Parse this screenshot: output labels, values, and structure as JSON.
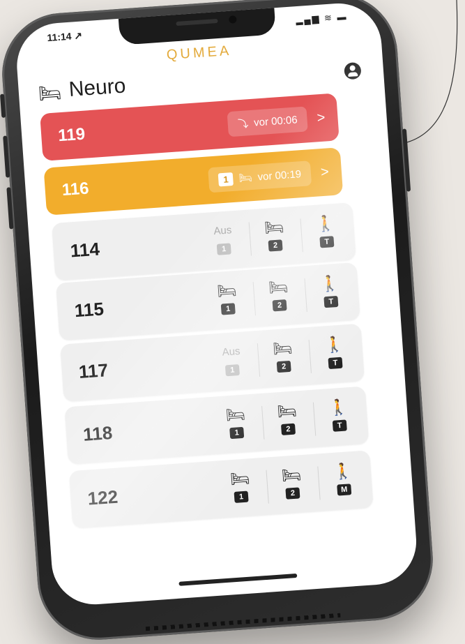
{
  "status": {
    "time": "11:14 ↗",
    "icons": "▂▄▆ ≋ ▬"
  },
  "app": {
    "logo": "QUMEA",
    "title": "Neuro",
    "bed_icon": "bed-icon",
    "user_icon": "user-icon"
  },
  "alerts": [
    {
      "room": "119",
      "icon": "fall-icon",
      "text": "vor 00:06",
      "chevron": ">",
      "color": "#e45355"
    },
    {
      "room": "116",
      "count": "1",
      "icon": "sit-up-bed-icon",
      "text": "vor 00:19",
      "chevron": ">",
      "color": "#f2ad2c"
    }
  ],
  "rooms": [
    {
      "room": "114",
      "cells": [
        {
          "label": "Aus",
          "tag": "1"
        },
        {
          "icon": "bed-icon",
          "tag": "2"
        },
        {
          "icon": "walking-icon",
          "tag": "T"
        }
      ]
    },
    {
      "room": "115",
      "cells": [
        {
          "icon": "bed-alert-icon",
          "tag": "1"
        },
        {
          "icon": "bed-icon",
          "tag": "2"
        },
        {
          "icon": "walking-icon",
          "tag": "T"
        }
      ]
    },
    {
      "room": "117",
      "cells": [
        {
          "label": "Aus",
          "tag": "1"
        },
        {
          "icon": "bed-icon",
          "tag": "2"
        },
        {
          "icon": "walking-icon",
          "tag": "T"
        }
      ]
    },
    {
      "room": "118",
      "cells": [
        {
          "icon": "bed-icon",
          "tag": "1"
        },
        {
          "icon": "bed-icon",
          "tag": "2"
        },
        {
          "icon": "walking-icon",
          "tag": "T"
        }
      ]
    },
    {
      "room": "122",
      "cells": [
        {
          "icon": "bed-exit-icon",
          "tag": "1"
        },
        {
          "icon": "bed-icon",
          "tag": "2"
        },
        {
          "icon": "walking-icon",
          "tag": "M"
        }
      ]
    }
  ]
}
